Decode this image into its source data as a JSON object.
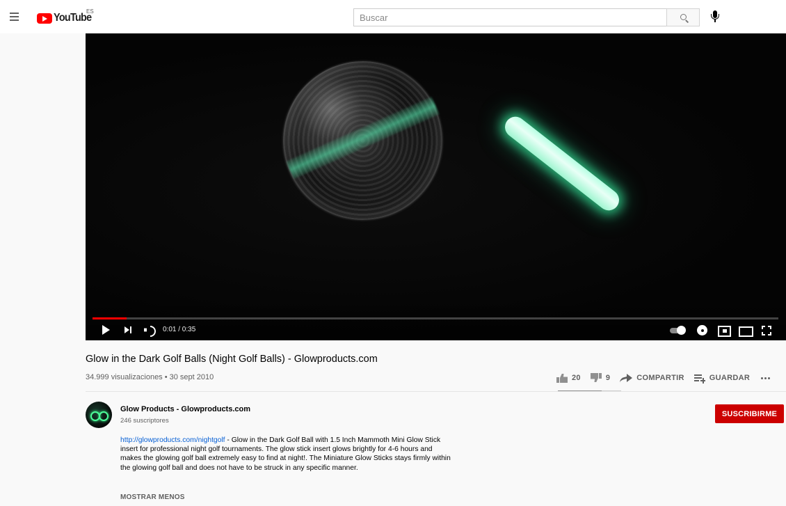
{
  "masthead": {
    "logo_text": "YouTube",
    "country_code": "ES",
    "search_placeholder": "Buscar"
  },
  "player": {
    "current_time": "0:01",
    "duration": "0:35",
    "time_display": "0:01 / 0:35",
    "progress_fraction": 0.05,
    "progress_color": "#ff0000"
  },
  "video": {
    "title": "Glow in the Dark Golf Balls (Night Golf Balls) - Glowproducts.com",
    "views_date": "34.999 visualizaciones • 30 sept 2010",
    "likes": "20",
    "dislikes": "9",
    "like_ratio": 0.69,
    "share_label": "COMPARTIR",
    "save_label": "GUARDAR"
  },
  "channel": {
    "name": "Glow Products - Glowproducts.com",
    "subscribers": "246 suscriptores",
    "subscribe_label": "SUSCRIBIRME",
    "subscribe_color": "#cc0000"
  },
  "description": {
    "link": "http://glowproducts.com/nightgolf",
    "text": " - Glow in the Dark Golf Ball with 1.5 Inch Mammoth Mini Glow Stick insert for professional night golf tournaments. The glow stick insert glows brightly for 4-6 hours and makes the glowing golf ball extremely easy to find at night!. The Miniature Glow Sticks stays firmly within the glowing golf ball and does not have to be struck in any specific manner.",
    "show_less_label": "MOSTRAR MENOS"
  },
  "icons": [
    "menu-icon",
    "youtube-logo-icon",
    "search-icon",
    "microphone-icon",
    "play-icon",
    "next-icon",
    "volume-icon",
    "autoplay-toggle-icon",
    "gear-icon",
    "miniplayer-icon",
    "theater-mode-icon",
    "fullscreen-icon",
    "thumbs-up-icon",
    "thumbs-down-icon",
    "share-icon",
    "save-playlist-icon",
    "more-icon"
  ]
}
